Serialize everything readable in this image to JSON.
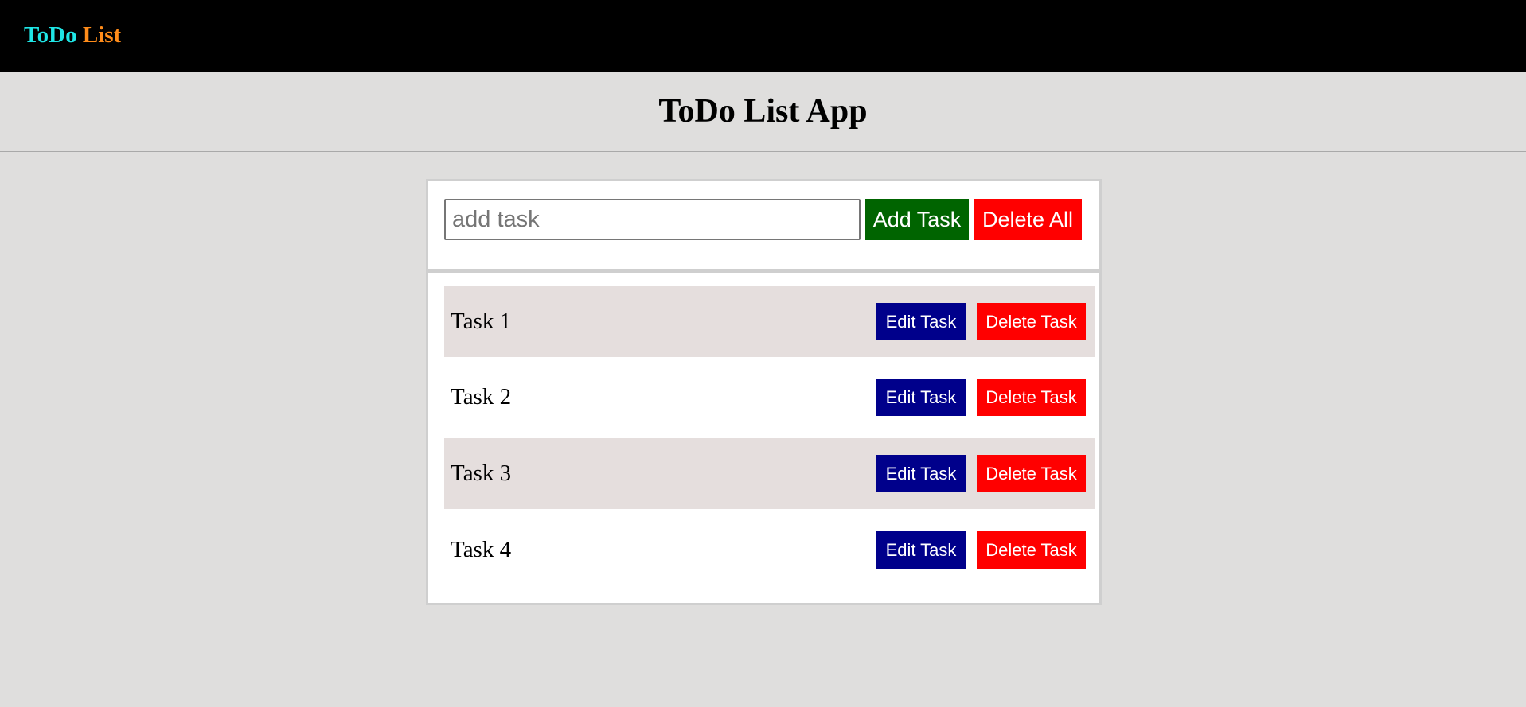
{
  "navbar": {
    "brand_part1": "ToDo",
    "brand_part2": "List",
    "brand_color1": "#1fe6e6",
    "brand_color2": "#ff8c1a"
  },
  "header": {
    "title": "ToDo List App"
  },
  "form": {
    "input_value": "",
    "input_placeholder": "add task",
    "add_label": "Add Task",
    "delete_all_label": "Delete All"
  },
  "tasks": [
    {
      "label": "Task 1",
      "edit_label": "Edit Task",
      "delete_label": "Delete Task"
    },
    {
      "label": "Task 2",
      "edit_label": "Edit Task",
      "delete_label": "Delete Task"
    },
    {
      "label": "Task 3",
      "edit_label": "Edit Task",
      "delete_label": "Delete Task"
    },
    {
      "label": "Task 4",
      "edit_label": "Edit Task",
      "delete_label": "Delete Task"
    }
  ],
  "colors": {
    "navbar_bg": "#000000",
    "page_bg": "#dfdedd",
    "add_button": "#006400",
    "delete_button": "#ff0000",
    "edit_button": "#00008b",
    "row_shade": "#e5dedd"
  }
}
